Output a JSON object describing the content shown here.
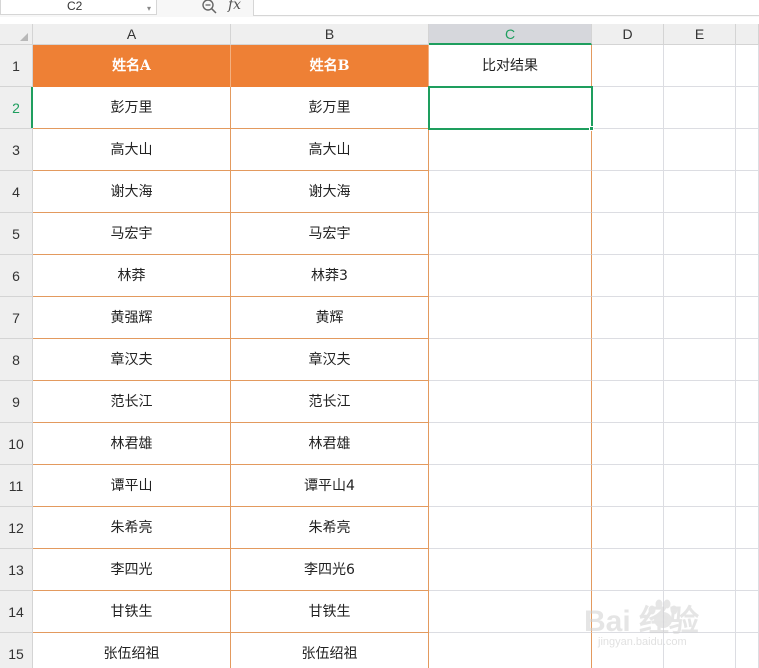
{
  "formula_bar": {
    "name_box": "C2",
    "fx_label": "fx",
    "formula": ""
  },
  "columns": [
    "A",
    "B",
    "C",
    "D",
    "E"
  ],
  "active_cell": "C2",
  "header_row": {
    "A": "姓名A",
    "B": "姓名B",
    "C": "比对结果"
  },
  "rows": [
    {
      "num": "1"
    },
    {
      "num": "2",
      "a": "彭万里",
      "b": "彭万里",
      "c": ""
    },
    {
      "num": "3",
      "a": "高大山",
      "b": "高大山",
      "c": ""
    },
    {
      "num": "4",
      "a": "谢大海",
      "b": "谢大海",
      "c": ""
    },
    {
      "num": "5",
      "a": "马宏宇",
      "b": "马宏宇",
      "c": ""
    },
    {
      "num": "6",
      "a": "林莽",
      "b": "林莽3",
      "c": ""
    },
    {
      "num": "7",
      "a": "黄强辉",
      "b": "黄辉",
      "c": ""
    },
    {
      "num": "8",
      "a": "章汉夫",
      "b": "章汉夫",
      "c": ""
    },
    {
      "num": "9",
      "a": "范长江",
      "b": "范长江",
      "c": ""
    },
    {
      "num": "10",
      "a": "林君雄",
      "b": "林君雄",
      "c": ""
    },
    {
      "num": "11",
      "a": "谭平山",
      "b": "谭平山4",
      "c": ""
    },
    {
      "num": "12",
      "a": "朱希亮",
      "b": "朱希亮",
      "c": ""
    },
    {
      "num": "13",
      "a": "李四光",
      "b": "李四光6",
      "c": ""
    },
    {
      "num": "14",
      "a": "甘铁生",
      "b": "甘铁生",
      "c": ""
    },
    {
      "num": "15",
      "a": "张伍绍祖",
      "b": "张伍绍祖",
      "c": ""
    }
  ],
  "watermark": {
    "brand": "Bai 经验",
    "sub": "jingyan.baidu.com"
  },
  "colors": {
    "header_fill": "#ee8035",
    "selection": "#1e9e5e",
    "table_border": "#e39a5e"
  }
}
